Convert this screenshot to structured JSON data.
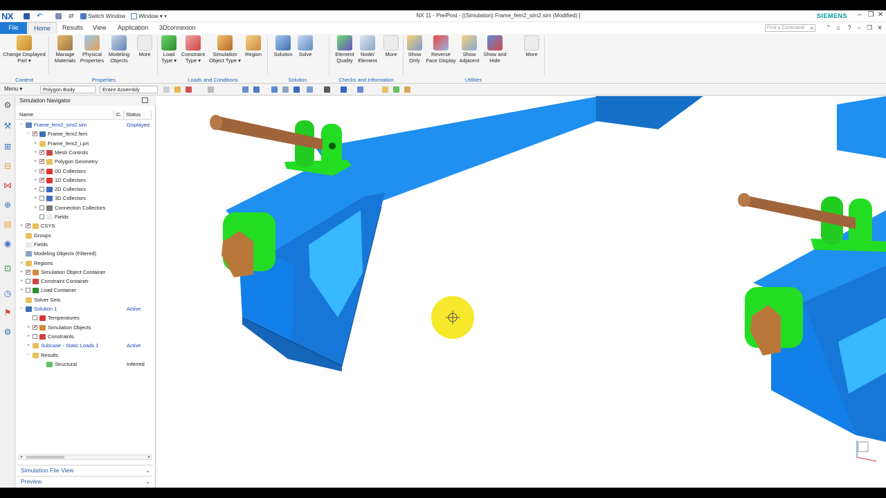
{
  "app": {
    "logo": "NX",
    "title": "NX 11 - Pre/Post - [(Simulation) Frame_fem2_sim2.sim (Modified) ]",
    "brand": "SIEMENS",
    "switch_window": "Switch Window",
    "window_menu": "Window ▾"
  },
  "tabs": [
    {
      "label": "File"
    },
    {
      "label": "Home"
    },
    {
      "label": "Results"
    },
    {
      "label": "View"
    },
    {
      "label": "Application"
    },
    {
      "label": "3Dconnexion"
    }
  ],
  "search": {
    "placeholder": "Find a Command"
  },
  "ribbon": {
    "change_displayed_part": "Change Displayed Part ▾",
    "manage_materials": "Manage Materials",
    "physical_properties": "Physical Properties",
    "modeling_objects": "Modeling Objects",
    "more": "More",
    "load_type": "Load Type ▾",
    "constraint_type": "Constraint Type ▾",
    "simulation_object_type": "Simulation Object Type ▾",
    "region": "Region",
    "solution": "Solution",
    "solve": "Solve",
    "element_quality": "Element Quality",
    "node_element": "Node/ Element",
    "show_only": "Show Only",
    "reverse_face_display": "Reverse Face Display",
    "show_adjacent": "Show Adjacent",
    "show_and_hide": "Show and Hide",
    "groups": {
      "context": "Context",
      "properties": "Properties",
      "loads_conditions": "Loads and Conditions",
      "solution": "Solution",
      "checks": "Checks and Information",
      "utilities": "Utilities"
    }
  },
  "toolbar": {
    "menu": "Menu ▾",
    "filter": "Polygon Body",
    "scope": "Entire Assembly"
  },
  "navigator": {
    "title": "Simulation Navigator",
    "col_name": "Name",
    "col_c": "C.",
    "col_status": "Status",
    "rows": [
      {
        "label": "Frame_fem2_sim2.sim",
        "status": "Displayed"
      },
      {
        "label": "Frame_fem2.fem",
        "status": ""
      },
      {
        "label": "Frame_fem2_i.prt",
        "status": ""
      },
      {
        "label": "Mesh Controls",
        "status": ""
      },
      {
        "label": "Polygon Geometry",
        "status": ""
      },
      {
        "label": "0D Collectors",
        "status": ""
      },
      {
        "label": "1D Collectors",
        "status": ""
      },
      {
        "label": "2D Collectors",
        "status": ""
      },
      {
        "label": "3D Collectors",
        "status": ""
      },
      {
        "label": "Connection Collectors",
        "status": ""
      },
      {
        "label": "Fields",
        "status": ""
      },
      {
        "label": "CSYS",
        "status": ""
      },
      {
        "label": "Groups",
        "status": ""
      },
      {
        "label": "Fields",
        "status": ""
      },
      {
        "label": "Modeling Objects (Filtered)",
        "status": ""
      },
      {
        "label": "Regions",
        "status": ""
      },
      {
        "label": "Simulation Object Container",
        "status": ""
      },
      {
        "label": "Constraint Container",
        "status": ""
      },
      {
        "label": "Load Container",
        "status": ""
      },
      {
        "label": "Solver Sets",
        "status": ""
      },
      {
        "label": "Solution 1",
        "status": "Active"
      },
      {
        "label": "Temperatures",
        "status": ""
      },
      {
        "label": "Simulation Objects",
        "status": ""
      },
      {
        "label": "Constraints",
        "status": ""
      },
      {
        "label": "Subcase - Static Loads 1",
        "status": "Active"
      },
      {
        "label": "Results",
        "status": ""
      },
      {
        "label": "Structural",
        "status": "Inferred"
      }
    ],
    "panels": [
      {
        "label": "Simulation File View"
      },
      {
        "label": "Preview"
      }
    ]
  },
  "colors": {
    "frame_blue": "#1f8ff0",
    "frame_dark": "#1570c8",
    "bracket_green": "#22dd22",
    "pin_brown": "#a0643a",
    "cursor_yellow": "#f5e619"
  }
}
